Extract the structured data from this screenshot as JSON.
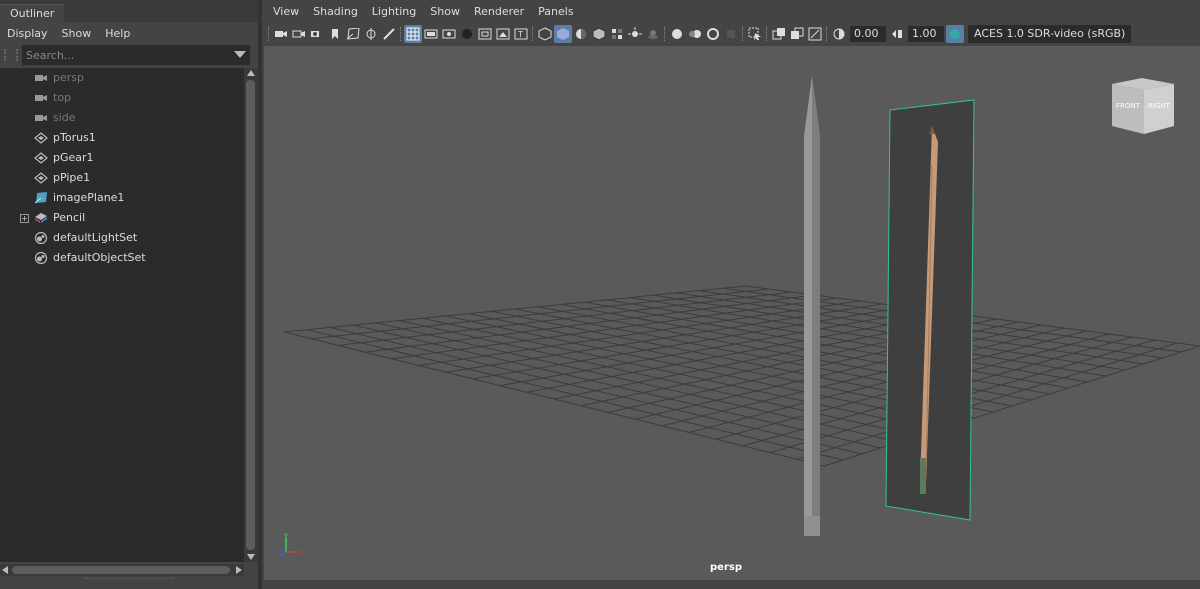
{
  "outliner": {
    "tab": "Outliner",
    "menus": [
      "Display",
      "Show",
      "Help"
    ],
    "search_placeholder": "Search...",
    "items": [
      {
        "label": "persp",
        "icon": "camera-icon",
        "dim": true
      },
      {
        "label": "top",
        "icon": "camera-icon",
        "dim": true
      },
      {
        "label": "side",
        "icon": "camera-icon",
        "dim": true
      },
      {
        "label": "pTorus1",
        "icon": "mesh-icon",
        "dim": false
      },
      {
        "label": "pGear1",
        "icon": "mesh-icon",
        "dim": false
      },
      {
        "label": "pPipe1",
        "icon": "mesh-icon",
        "dim": false
      },
      {
        "label": "imagePlane1",
        "icon": "image-plane-icon",
        "dim": false
      },
      {
        "label": "Pencil",
        "icon": "group-icon",
        "dim": false,
        "expander": "+"
      },
      {
        "label": "defaultLightSet",
        "icon": "set-icon",
        "dim": false
      },
      {
        "label": "defaultObjectSet",
        "icon": "set-icon",
        "dim": false
      }
    ]
  },
  "viewport": {
    "menus": [
      "View",
      "Shading",
      "Lighting",
      "Show",
      "Renderer",
      "Panels"
    ],
    "exposure": "0.00",
    "gamma": "1.00",
    "color_management": "ACES 1.0 SDR-video (sRGB)",
    "camera_label": "persp",
    "viewcube": {
      "front": "FRONT",
      "right": "RIGHT"
    },
    "axis": {
      "x": "x",
      "y": "y",
      "z": "z"
    },
    "colors": {
      "background": "#5a5a5a",
      "grid": "#3c3c3c",
      "accent": "#5a7fa6",
      "image_plane_border": "#35c0a0"
    }
  }
}
